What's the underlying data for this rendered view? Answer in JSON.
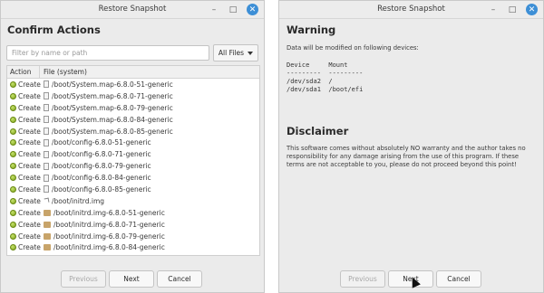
{
  "left": {
    "title": "Restore Snapshot",
    "heading": "Confirm Actions",
    "filter_placeholder": "Filter by name or path",
    "filter_dropdown": "All Files",
    "columns": {
      "action": "Action",
      "file": "File (system)"
    },
    "rows": [
      {
        "action": "Create",
        "path": "/boot/System.map-6.8.0-51-generic",
        "icon": "file-icon"
      },
      {
        "action": "Create",
        "path": "/boot/System.map-6.8.0-71-generic",
        "icon": "file-icon"
      },
      {
        "action": "Create",
        "path": "/boot/System.map-6.8.0-79-generic",
        "icon": "file-icon"
      },
      {
        "action": "Create",
        "path": "/boot/System.map-6.8.0-84-generic",
        "icon": "file-icon"
      },
      {
        "action": "Create",
        "path": "/boot/System.map-6.8.0-85-generic",
        "icon": "file-icon"
      },
      {
        "action": "Create",
        "path": "/boot/config-6.8.0-51-generic",
        "icon": "file-icon"
      },
      {
        "action": "Create",
        "path": "/boot/config-6.8.0-71-generic",
        "icon": "file-icon"
      },
      {
        "action": "Create",
        "path": "/boot/config-6.8.0-79-generic",
        "icon": "file-icon"
      },
      {
        "action": "Create",
        "path": "/boot/config-6.8.0-84-generic",
        "icon": "file-icon"
      },
      {
        "action": "Create",
        "path": "/boot/config-6.8.0-85-generic",
        "icon": "file-icon"
      },
      {
        "action": "Create",
        "path": "/boot/initrd.img",
        "icon": "symlink-icon"
      },
      {
        "action": "Create",
        "path": "/boot/initrd.img-6.8.0-51-generic",
        "icon": "archive-icon"
      },
      {
        "action": "Create",
        "path": "/boot/initrd.img-6.8.0-71-generic",
        "icon": "archive-icon"
      },
      {
        "action": "Create",
        "path": "/boot/initrd.img-6.8.0-79-generic",
        "icon": "archive-icon"
      },
      {
        "action": "Create",
        "path": "/boot/initrd.img-6.8.0-84-generic",
        "icon": "archive-icon"
      }
    ],
    "buttons": {
      "previous": "Previous",
      "next": "Next",
      "cancel": "Cancel"
    }
  },
  "right": {
    "title": "Restore Snapshot",
    "warning_heading": "Warning",
    "warning_text": "Data will be modified on following devices:",
    "device_table": "Device     Mount\n---------  ---------\n/dev/sda2  /\n/dev/sda1  /boot/efi",
    "disclaimer_heading": "Disclaimer",
    "disclaimer_text": "This software comes without absolutely NO warranty and the author takes no responsibility for any damage arising from the use of this program. If these terms are not acceptable to you, please do not proceed beyond this point!",
    "buttons": {
      "previous": "Previous",
      "next": "Next",
      "cancel": "Cancel"
    }
  },
  "window_controls": {
    "minimize": "–",
    "maximize": "□",
    "close": "✕"
  }
}
